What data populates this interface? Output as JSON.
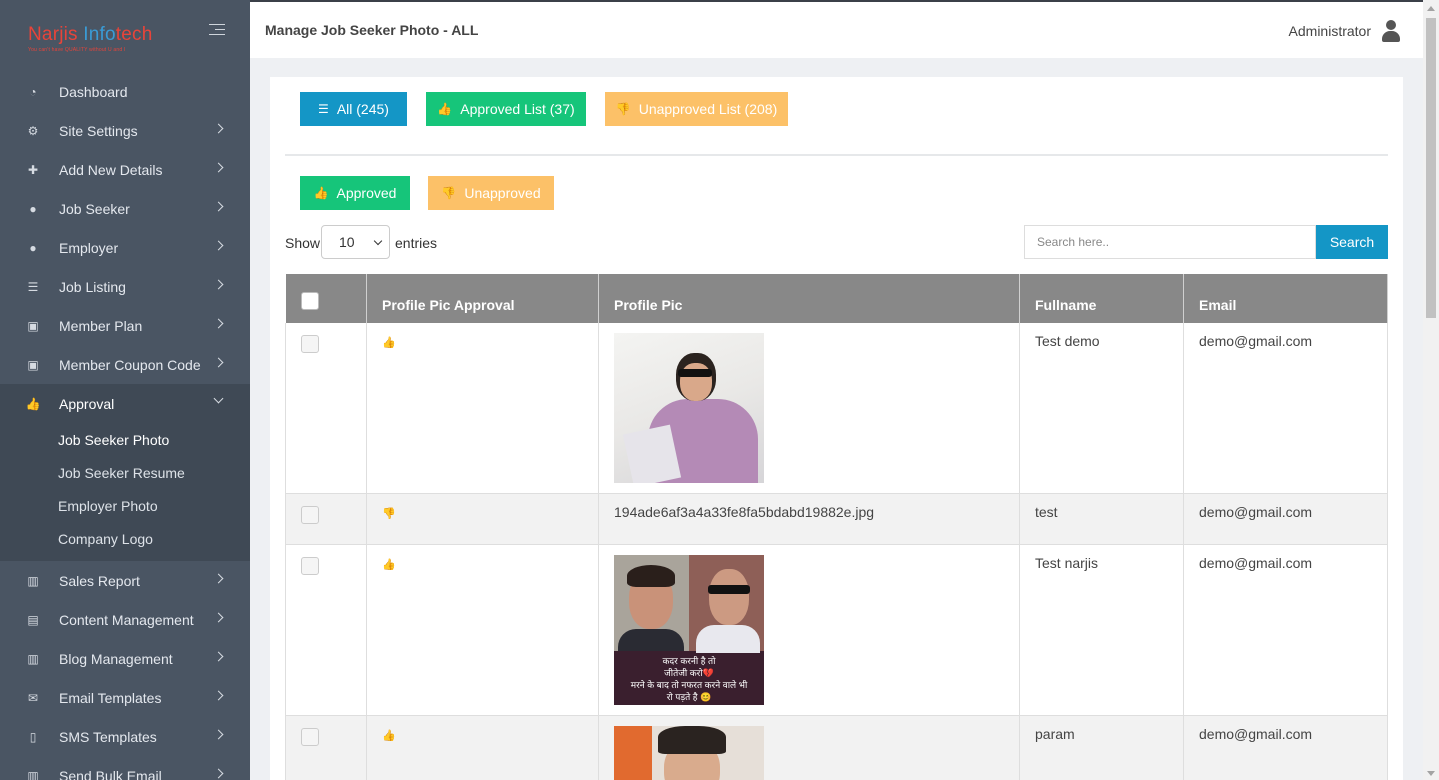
{
  "brand": {
    "name_part1": "Narjis ",
    "name_part2": "Info",
    "name_part3": "tech",
    "tagline": "You can't have QUALITY without U and I"
  },
  "sidebar": {
    "items": [
      {
        "label": "Dashboard",
        "icon": "dashboard-icon"
      },
      {
        "label": "Site Settings",
        "icon": "cogs-icon"
      },
      {
        "label": "Add New Details",
        "icon": "plus-icon"
      },
      {
        "label": "Job Seeker",
        "icon": "user-icon"
      },
      {
        "label": "Employer",
        "icon": "user-icon"
      },
      {
        "label": "Job Listing",
        "icon": "list-icon"
      },
      {
        "label": "Member Plan",
        "icon": "money-icon"
      },
      {
        "label": "Member Coupon Code",
        "icon": "money-icon"
      },
      {
        "label": "Approval",
        "icon": "thumbs-up-icon"
      },
      {
        "label": "Sales Report",
        "icon": "bar-chart-icon"
      },
      {
        "label": "Content Management",
        "icon": "book-icon"
      },
      {
        "label": "Blog Management",
        "icon": "bar-chart-icon"
      },
      {
        "label": "Email Templates",
        "icon": "envelope-icon"
      },
      {
        "label": "SMS Templates",
        "icon": "mobile-icon"
      },
      {
        "label": "Send Bulk Email",
        "icon": "bar-chart-icon"
      }
    ],
    "approval_sub": [
      {
        "label": "Job Seeker Photo"
      },
      {
        "label": "Job Seeker Resume"
      },
      {
        "label": "Employer Photo"
      },
      {
        "label": "Company Logo"
      }
    ]
  },
  "header": {
    "title": "Manage Job Seeker Photo - ALL",
    "user": "Administrator"
  },
  "filters": {
    "all": "All (245)",
    "approved_list": "Approved List (37)",
    "unapproved_list": "Unapproved List (208)"
  },
  "actions": {
    "approved": "Approved",
    "unapproved": "Unapproved"
  },
  "table_controls": {
    "show": "Show",
    "entries_value": "10",
    "entries": "entries",
    "search_placeholder": "Search here..",
    "search_button": "Search"
  },
  "table": {
    "columns": [
      "Profile Pic Approval",
      "Profile Pic",
      "Fullname",
      "Email"
    ],
    "rows": [
      {
        "approval": "up",
        "pic": "image",
        "pic_text": "",
        "fullname": "Test demo",
        "email": "demo@gmail.com"
      },
      {
        "approval": "down",
        "pic": "text",
        "pic_text": "194ade6af3a4a33fe8fa5bdabd19882e.jpg",
        "fullname": "test",
        "email": "demo@gmail.com"
      },
      {
        "approval": "up",
        "pic": "image",
        "pic_text": "",
        "fullname": "Test narjis",
        "email": "demo@gmail.com"
      },
      {
        "approval": "up",
        "pic": "image",
        "pic_text": "",
        "fullname": "param",
        "email": "demo@gmail.com"
      }
    ],
    "photo3_caption": [
      "कदर करनी है तो",
      "जीतेजी करो💔",
      "मरने के बाद तो नफरत करने वाले भी",
      "रो पड़ते है 😊"
    ]
  },
  "colors": {
    "sidebar_bg": "#4a5563",
    "primary": "#1496c6",
    "success": "#16c57a",
    "warning": "#fcc168",
    "table_header": "#888888"
  }
}
